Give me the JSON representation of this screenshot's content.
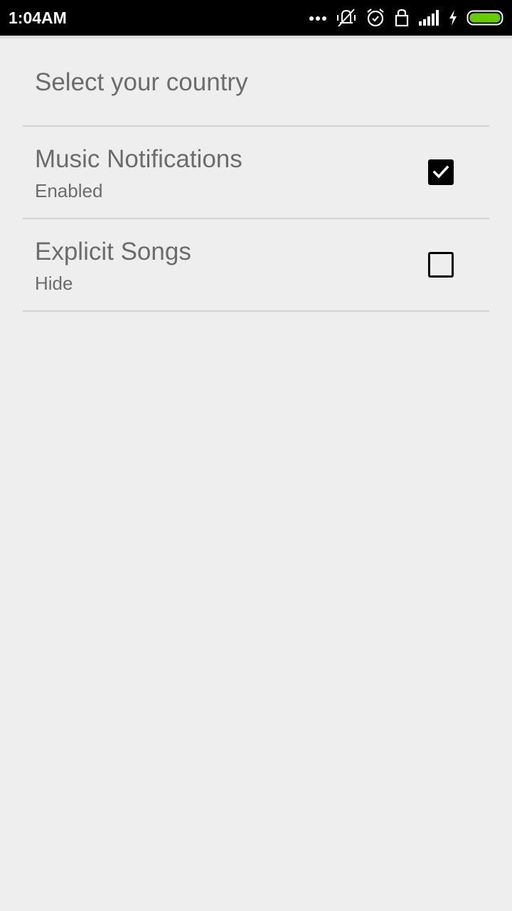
{
  "status_bar": {
    "time": "1:04AM",
    "icons": [
      "more-dots-icon",
      "vibrate-off-icon",
      "alarm-icon",
      "lock-icon",
      "signal-icon",
      "charging-icon",
      "battery-icon"
    ],
    "battery_color": "#66cc00"
  },
  "settings": {
    "header": {
      "title": "Select your country"
    },
    "items": [
      {
        "title": "Music Notifications",
        "summary": "Enabled",
        "checked": true
      },
      {
        "title": "Explicit Songs",
        "summary": "Hide",
        "checked": false
      }
    ]
  }
}
